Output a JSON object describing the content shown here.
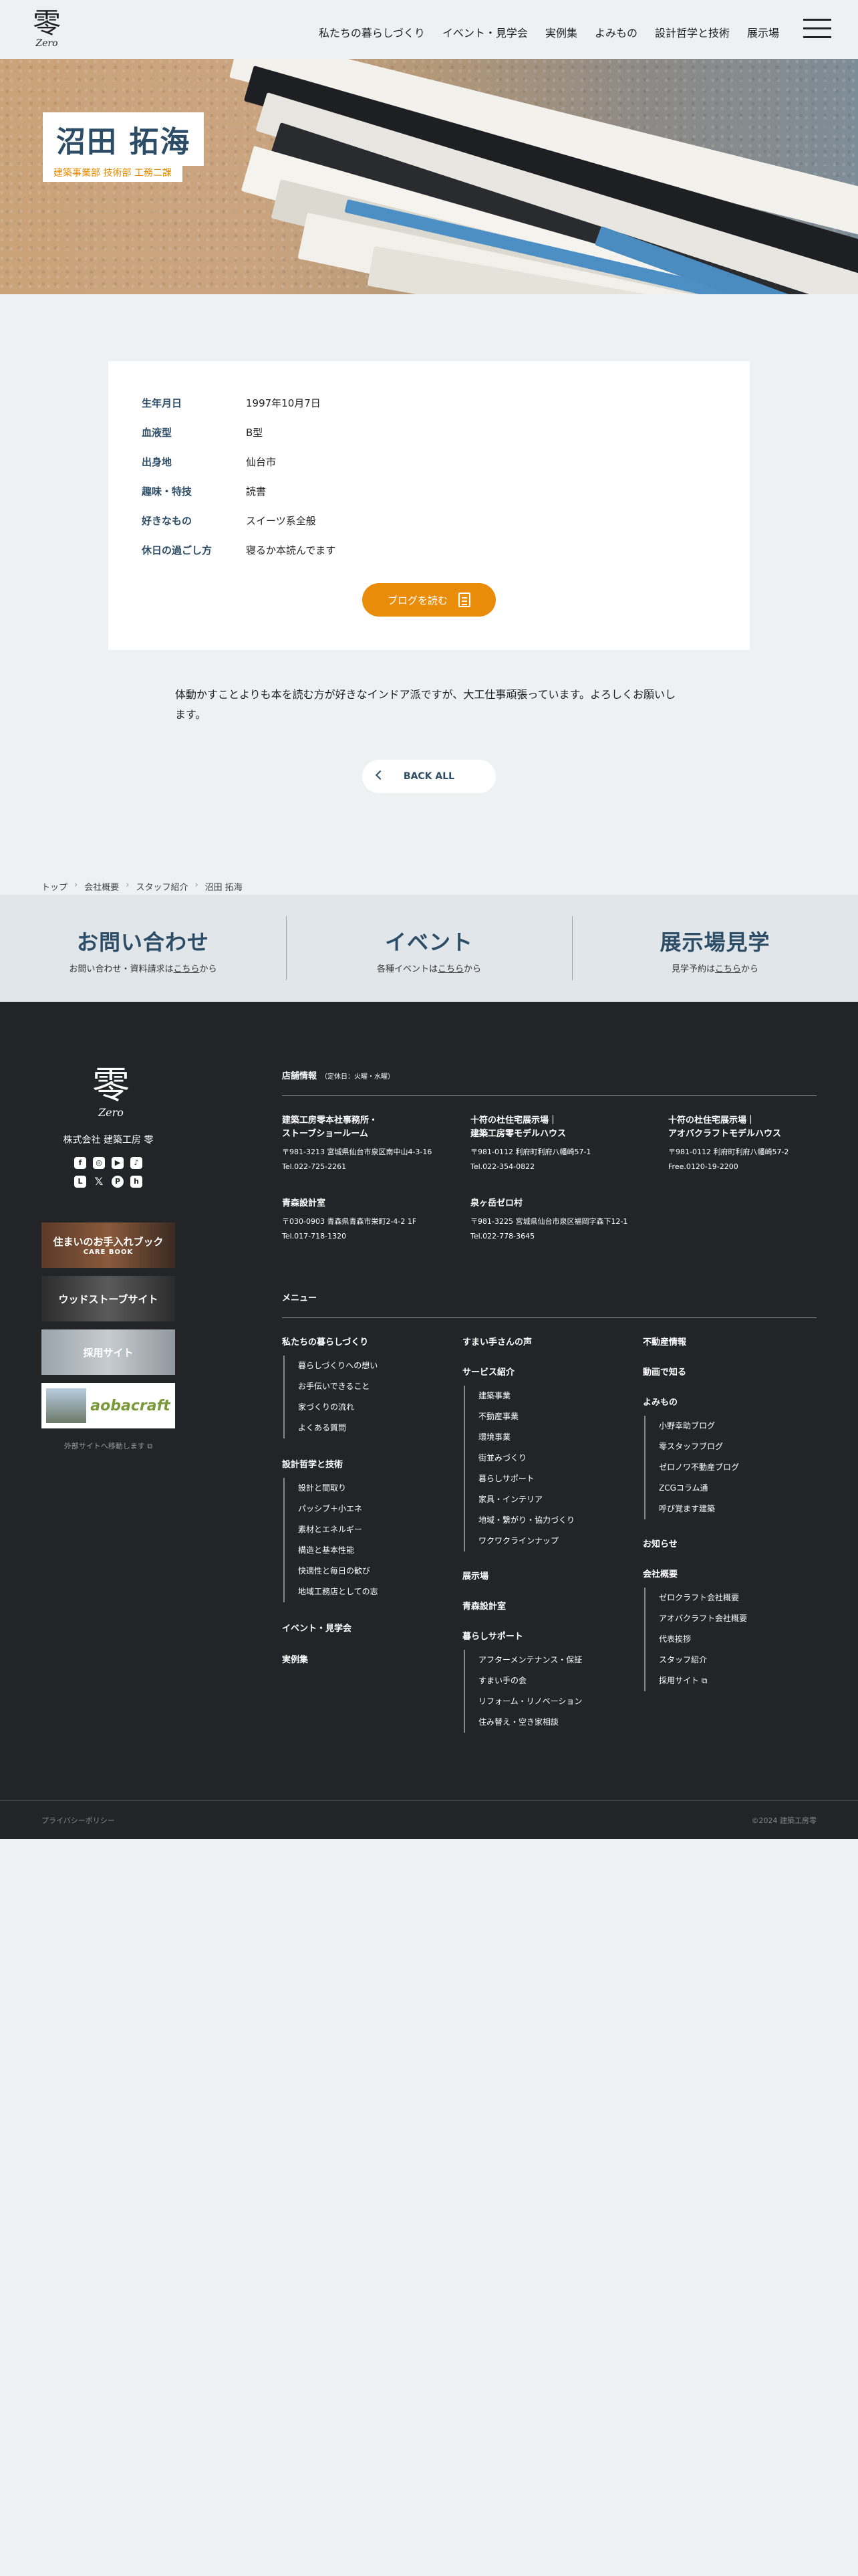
{
  "header": {
    "logo_kanji": "零",
    "logo_sub": "Zero",
    "nav": [
      "私たちの暮らしづくり",
      "イベント・見学会",
      "実例集",
      "よみもの",
      "設計哲学と技術",
      "展示場"
    ]
  },
  "hero": {
    "name": "沼田 拓海",
    "department": "建築事業部 技術部 工務二課"
  },
  "profile": {
    "rows": [
      {
        "label": "生年月日",
        "value": "1997年10月7日"
      },
      {
        "label": "血液型",
        "value": "B型"
      },
      {
        "label": "出身地",
        "value": "仙台市"
      },
      {
        "label": "趣味・特技",
        "value": "読書"
      },
      {
        "label": "好きなもの",
        "value": "スイーツ系全般"
      },
      {
        "label": "休日の過ごし方",
        "value": "寝るか本読んでます"
      }
    ],
    "blog_button": "ブログを読む"
  },
  "intro": "体動かすことよりも本を読む方が好きなインドア派ですが、大工仕事頑張っています。よろしくお願いします。",
  "back_button": "BACK ALL",
  "breadcrumb": [
    "トップ",
    "会社概要",
    "スタッフ紹介",
    "沼田 拓海"
  ],
  "cta": [
    {
      "title": "お問い合わせ",
      "sub_pre": "お問い合わせ・資料請求は",
      "sub_link": "こちら",
      "sub_post": "から"
    },
    {
      "title": "イベント",
      "sub_pre": "各種イベントは",
      "sub_link": "こちら",
      "sub_post": "から"
    },
    {
      "title": "展示場見学",
      "sub_pre": "見学予約は",
      "sub_link": "こちら",
      "sub_post": "から"
    }
  ],
  "footer": {
    "logo_kanji": "零",
    "logo_sub": "Zero",
    "company": "株式会社 建築工房 零",
    "banners": [
      {
        "title": "住まいのお手入れブック",
        "sub": "CARE BOOK"
      },
      {
        "title": "ウッドストーブサイト",
        "sub": ""
      },
      {
        "title": "採用サイト",
        "sub": ""
      },
      {
        "title": "aobacraft",
        "sub": ""
      }
    ],
    "external_note": "外部サイトへ移動します",
    "stores_heading": "店舗情報",
    "stores_note": "（定休日：火曜・水曜）",
    "stores": [
      {
        "name1": "建築工房零本社事務所・",
        "name2": "ストーブショールーム",
        "addr": "〒981-3213 宮城県仙台市泉区南中山4-3-16",
        "tel": "Tel.022-725-2261"
      },
      {
        "name1": "十符の杜住宅展示場｜",
        "name2": "建築工房零モデルハウス",
        "addr": "〒981-0112 利府町利府八幡崎57-1",
        "tel": "Tel.022-354-0822"
      },
      {
        "name1": "十符の杜住宅展示場｜",
        "name2": "アオバクラフトモデルハウス",
        "addr": "〒981-0112 利府町利府八幡崎57-2",
        "tel": "Free.0120-19-2200"
      },
      {
        "name1": "青森設計室",
        "name2": "",
        "addr": "〒030-0903 青森県青森市栄町2-4-2 1F",
        "tel": "Tel.017-718-1320"
      },
      {
        "name1": "泉ヶ岳ゼロ村",
        "name2": "",
        "addr": "〒981-3225 宮城県仙台市泉区福岡字森下12-1",
        "tel": "Tel.022-778-3645"
      }
    ],
    "menu_heading": "メニュー",
    "menu": {
      "col1": [
        {
          "title": "私たちの暮らしづくり",
          "items": [
            "暮らしづくりへの想い",
            "お手伝いできること",
            "家づくりの流れ",
            "よくある質問"
          ]
        },
        {
          "title": "設計哲学と技術",
          "items": [
            "設計と間取り",
            "パッシブ＋小エネ",
            "素材とエネルギー",
            "構造と基本性能",
            "快適性と毎日の歓び",
            "地域工務店としての志"
          ]
        },
        {
          "title": "イベント・見学会",
          "items": []
        },
        {
          "title": "実例集",
          "items": []
        }
      ],
      "col2": [
        {
          "title": "すまい手さんの声",
          "items": []
        },
        {
          "title": "サービス紹介",
          "items": [
            "建築事業",
            "不動産事業",
            "環境事業",
            "街並みづくり",
            "暮らしサポート",
            "家具・インテリア",
            "地域・繋がり・協力づくり",
            "ワクワクラインナップ"
          ]
        },
        {
          "title": "展示場",
          "items": []
        },
        {
          "title": "青森設計室",
          "items": []
        },
        {
          "title": "暮らしサポート",
          "items": [
            "アフターメンテナンス・保証",
            "すまい手の会",
            "リフォーム・リノベーション",
            "住み替え・空き家相談"
          ]
        }
      ],
      "col3": [
        {
          "title": "不動産情報",
          "items": []
        },
        {
          "title": "動画で知る",
          "items": []
        },
        {
          "title": "よみもの",
          "items": [
            "小野幸助ブログ",
            "零スタッフブログ",
            "ゼロノワ不動産ブログ",
            "ZCGコラム通",
            "呼び覚ます建築"
          ]
        },
        {
          "title": "お知らせ",
          "items": []
        },
        {
          "title": "会社概要",
          "items": [
            "ゼロクラフト会社概要",
            "アオバクラフト会社概要",
            "代表挨拶",
            "スタッフ紹介",
            "採用サイト"
          ]
        }
      ]
    },
    "privacy": "プライバシーポリシー",
    "copyright": "©2024 建築工房零"
  },
  "colors": {
    "accent": "#e98c0a",
    "navy": "#2d4d66",
    "footer_bg": "#232427",
    "cta_bg": "#e1e6ea"
  }
}
